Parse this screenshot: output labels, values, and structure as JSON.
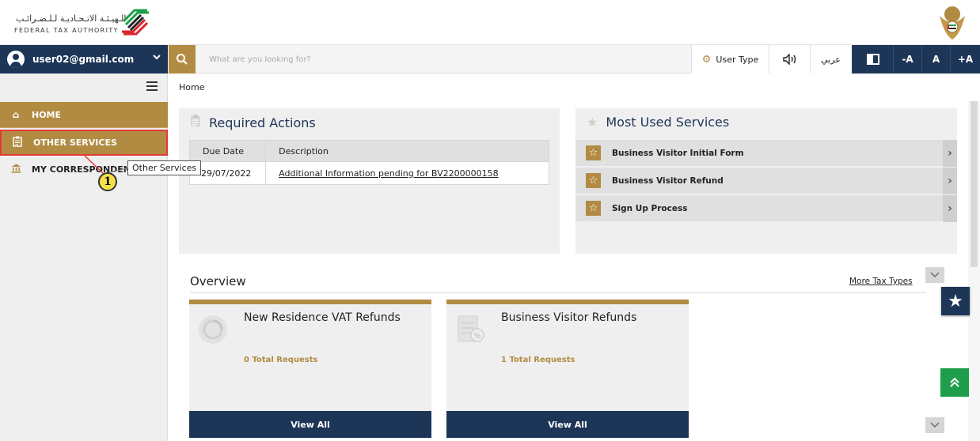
{
  "header": {
    "logo_arabic": "الـهيـئـة الاتـحـاديـة لـلـضـرائـب",
    "logo_english": "FEDERAL TAX AUTHORITY"
  },
  "navbar": {
    "user_email": "user02@gmail.com",
    "search_placeholder": "What are you looking for?",
    "user_type_label": "User Type",
    "arabic_label": "عربي",
    "decrease_font": "-A",
    "normal_font": "A",
    "increase_font": "+A"
  },
  "sidebar": {
    "items": [
      {
        "label": "HOME",
        "icon": "home-icon"
      },
      {
        "label": "OTHER SERVICES",
        "icon": "clipboard-icon"
      },
      {
        "label": "MY CORRESPONDENC",
        "icon": "bank-icon"
      }
    ]
  },
  "breadcrumb": "Home",
  "required_actions": {
    "title": "Required Actions",
    "columns": [
      "Due Date",
      "Description"
    ],
    "rows": [
      {
        "due": "• 29/07/2022",
        "description": "Additional Information pending for BV2200000158"
      }
    ]
  },
  "most_used": {
    "title": "Most Used Services",
    "items": [
      "Business Visitor Initial Form",
      "Business Visitor Refund",
      "Sign Up Process"
    ]
  },
  "overview": {
    "title": "Overview",
    "more_link": "More Tax Types",
    "cards": [
      {
        "title": "New Residence VAT Refunds",
        "count": "0 Total Requests",
        "button": "View All"
      },
      {
        "title": "Business Visitor Refunds",
        "count": "1 Total Requests",
        "button": "View All"
      }
    ]
  },
  "annotation": {
    "tooltip": "Other Services",
    "step": "1"
  },
  "colors": {
    "navy": "#1d3557",
    "gold": "#b28b42",
    "green": "#1e9e4a",
    "highlight": "#e53935"
  }
}
